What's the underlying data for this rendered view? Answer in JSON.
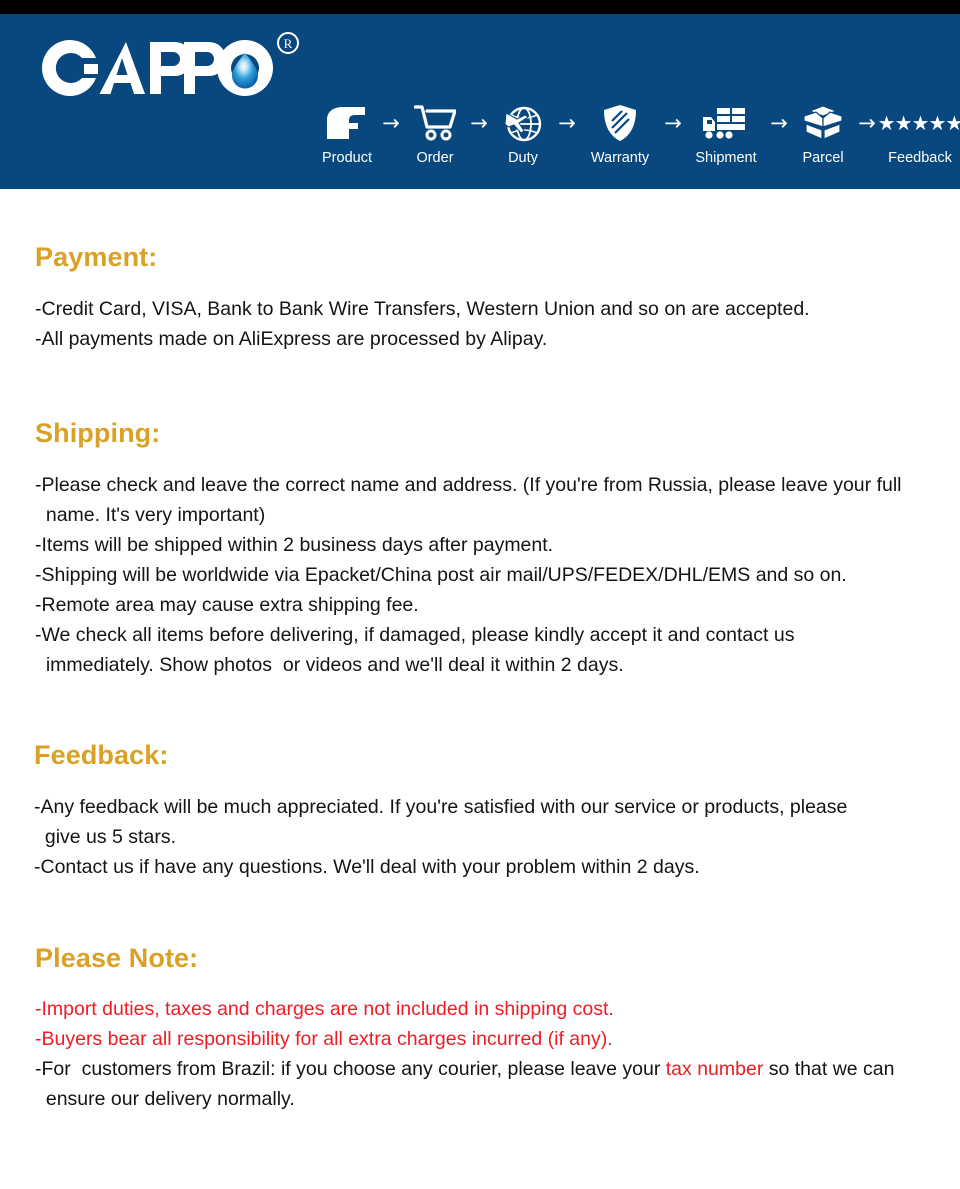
{
  "brand": {
    "name": "GAPPO",
    "registered_mark": "®",
    "logo_drop_icon": "water-drop-icon",
    "banner_color": "#08487E",
    "heading_color": "#D9A125",
    "alert_color": "#EE1C25"
  },
  "process_bar": {
    "arrow_glyph": "→",
    "steps": [
      {
        "label": "Product",
        "icon": "faucet-icon"
      },
      {
        "label": "Order",
        "icon": "shopping-cart-icon"
      },
      {
        "label": "Duty",
        "icon": "globe-airplane-icon"
      },
      {
        "label": "Warranty",
        "icon": "shield-icon"
      },
      {
        "label": "Shipment",
        "icon": "delivery-truck-icon"
      },
      {
        "label": "Parcel",
        "icon": "open-box-icon"
      },
      {
        "label": "Feedback",
        "icon": "five-stars-icon",
        "stars": "★★★★★"
      }
    ]
  },
  "sections": {
    "payment": {
      "heading": "Payment:",
      "bullets": [
        "-Credit Card, VISA, Bank to Bank Wire Transfers, Western Union and so on are accepted.",
        "-All payments made on AliExpress are processed by Alipay."
      ]
    },
    "shipping": {
      "heading": "Shipping:",
      "bullets": [
        "-Please check and leave the correct name and address. (If you're from Russia, please leave your full\n  name. It's very important)",
        "-Items will be shipped within 2 business days after payment.",
        "-Shipping will be worldwide via Epacket/China post air mail/UPS/FEDEX/DHL/EMS and so on.",
        "-Remote area may cause extra shipping fee.",
        "-We check all items before delivering, if damaged, please kindly accept it and contact us\n  immediately. Show photos  or videos and we'll deal it within 2 days."
      ]
    },
    "feedback": {
      "heading": "Feedback:",
      "bullets": [
        "-Any feedback will be much appreciated. If you're satisfied with our service or products, please\n  give us 5 stars.",
        "-Contact us if have any questions. We'll deal with your problem within 2 days."
      ]
    },
    "please_note": {
      "heading": "Please Note:",
      "bullets": [
        "-Import duties, taxes and charges are not included in shipping cost.",
        "-Buyers bear all responsibility for all extra charges incurred (if any)."
      ],
      "brazil_note": {
        "part1": "-For  customers from Brazil: if you choose any courier, please leave your ",
        "highlight": "tax number",
        "part2": " so that we can\n  ensure our delivery normally."
      }
    }
  }
}
